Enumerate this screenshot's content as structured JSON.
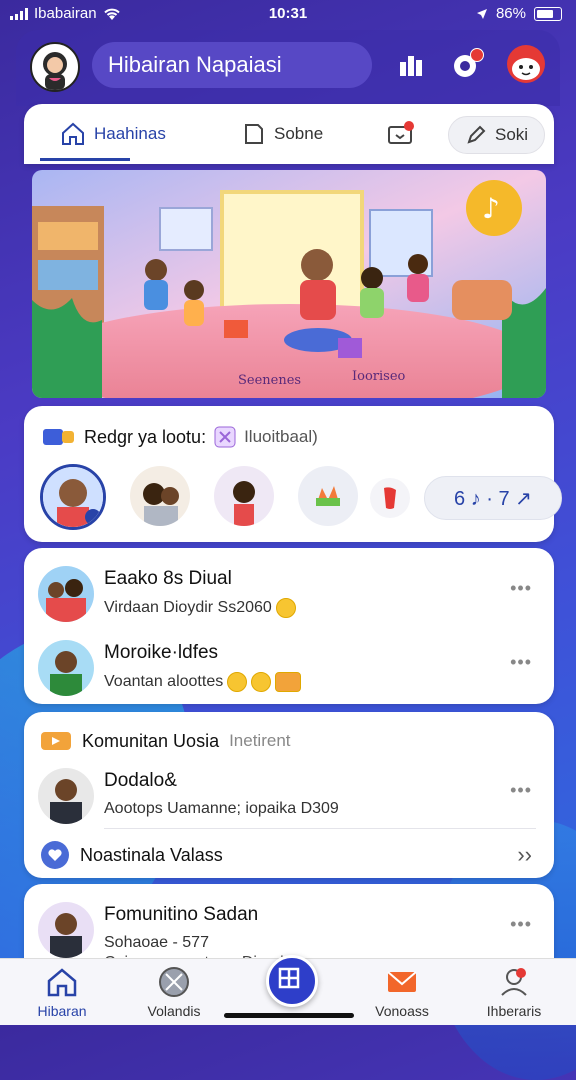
{
  "status": {
    "carrier": "Ibabairan",
    "time": "10:31",
    "battery": "86%"
  },
  "header": {
    "search_text": "Hibairan Napaiasi"
  },
  "tabs": [
    {
      "label": "Haahinas"
    },
    {
      "label": "Sobne"
    },
    {
      "label": "Soki"
    }
  ],
  "banner": {
    "caption_left": "Seenenes",
    "caption_right": "Iooriseo"
  },
  "stories": {
    "title": "Redgr ya lootu:",
    "subtitle": "Iluoitbaal)",
    "music_note": "6 ♪ · 7 ↗"
  },
  "feed": [
    {
      "name": "Eaako 8s Diual",
      "sub": "Virdaan Dioydir Ss2060"
    },
    {
      "name": "Moroike·ldfes",
      "sub": "Voantan aloottes"
    }
  ],
  "community": {
    "title": "Komunitan Uosia",
    "tag": "Inetirent",
    "member_name": "Dodalo&",
    "member_sub": "Aootops Uamanne; iopaika D309",
    "notif_label": "Noastinala Valass"
  },
  "last": {
    "name": "Fomunitino Sadan",
    "sub": "Sohaoae - 577",
    "sub2": "Cuimunonmorteerr Dioraie"
  },
  "nav": [
    {
      "label": "Hibaran"
    },
    {
      "label": "Volandis"
    },
    {
      "label": ""
    },
    {
      "label": "Vonoass"
    },
    {
      "label": "Ihberaris"
    }
  ],
  "colors": {
    "accent": "#2843a8",
    "bg": "#3b2a9e",
    "badge": "#e53935"
  }
}
